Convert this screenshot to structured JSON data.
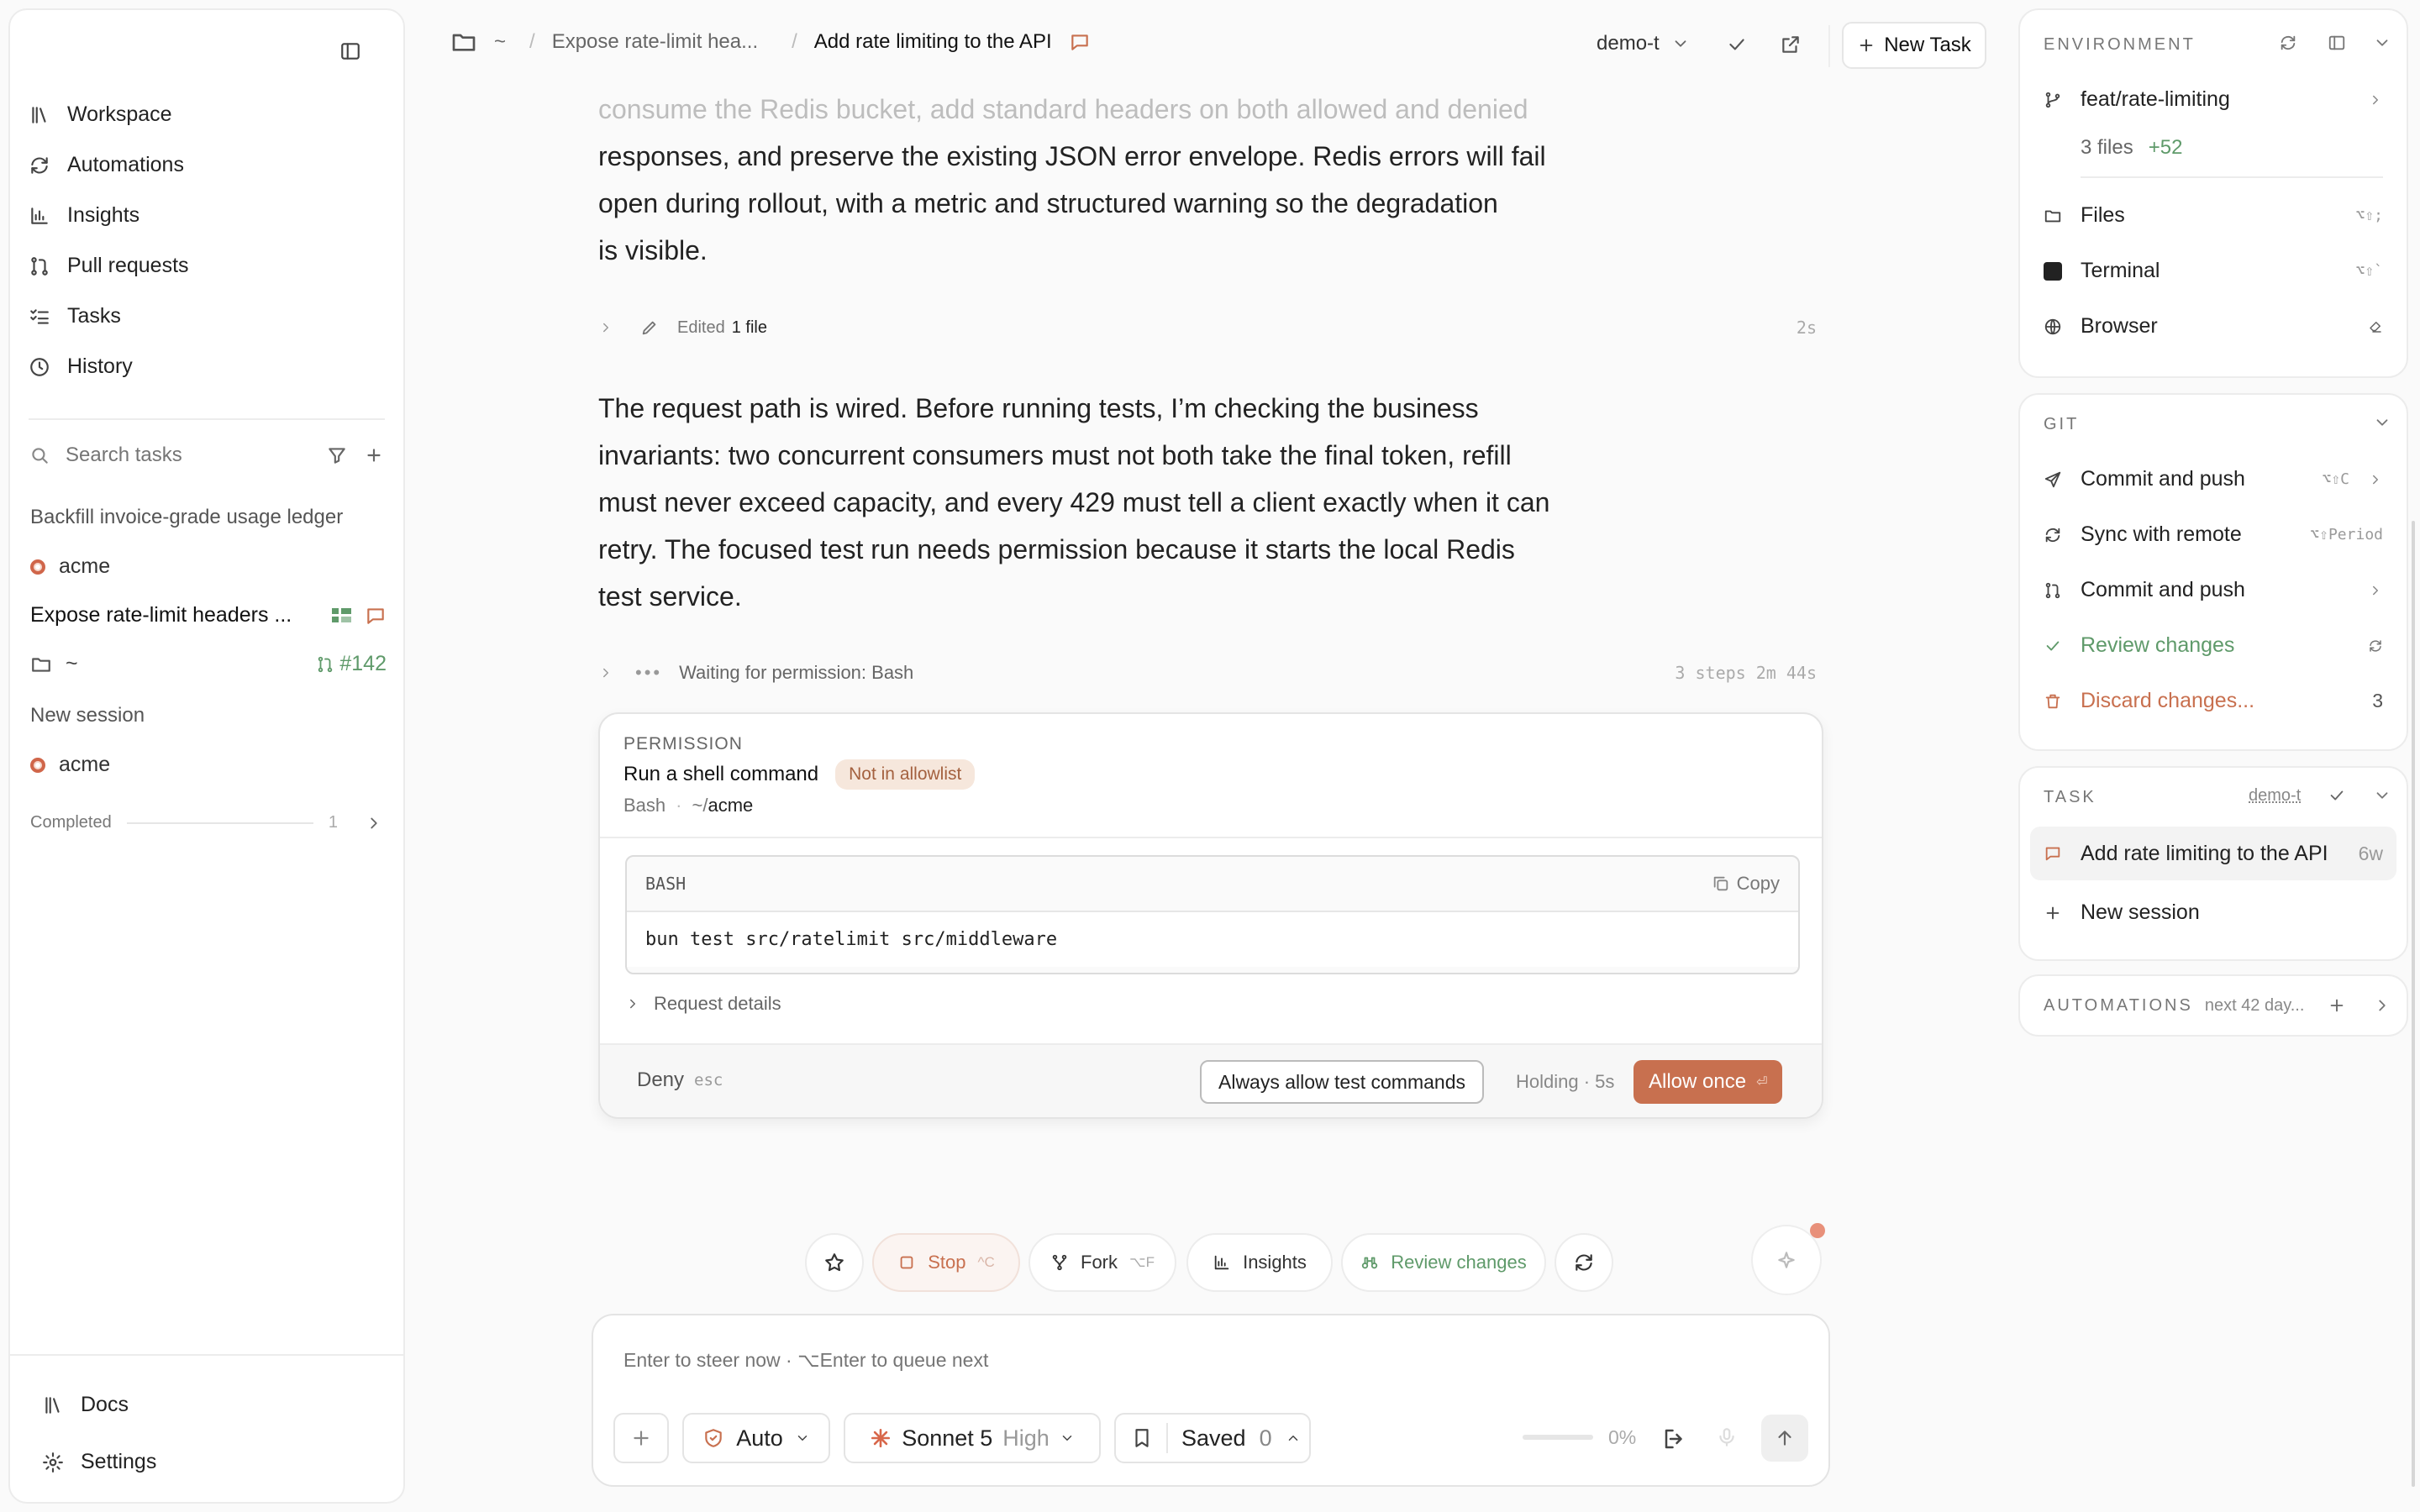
{
  "sidebar": {
    "nav": [
      "Workspace",
      "Automations",
      "Insights",
      "Pull requests",
      "Tasks",
      "History"
    ],
    "search_placeholder": "Search tasks",
    "tasks": [
      {
        "title": "Backfill invoice-grade usage ledger",
        "repo": "acme"
      },
      {
        "title": "Expose rate-limit headers ...",
        "dir": "~",
        "pr": "#142"
      },
      {
        "title": "New session",
        "repo": "acme"
      }
    ],
    "completed_label": "Completed",
    "completed_count": "1",
    "docs": "Docs",
    "settings": "Settings"
  },
  "header": {
    "crumb_home": "~",
    "crumb_parent": "Expose rate-limit hea...",
    "crumb_current": "Add rate limiting to the API",
    "branch_select": "demo-t",
    "new_task": "New Task"
  },
  "conversation": {
    "para1_faded": "consume the Redis bucket, add standard headers on both allowed and denied",
    "para1": [
      "responses, and preserve the existing JSON error envelope. Redis errors will fail",
      "open during rollout, with a metric and structured warning so the degradation",
      "is visible."
    ],
    "edited_prefix": "Edited",
    "edited_count": "1 file",
    "edited_time": "2s",
    "para2": [
      "The request path is wired. Before running tests, I’m checking the business",
      "invariants: two concurrent consumers must not both take the final token, refill",
      "must never exceed capacity, and every 429 must tell a client exactly when it can",
      "retry. The focused test run needs permission because it starts the local Redis",
      "test service."
    ],
    "waiting": "Waiting for permission: Bash",
    "waiting_stats": "3 steps 2m 44s"
  },
  "permission": {
    "label": "PERMISSION",
    "title": "Run a shell command",
    "badge": "Not in allowlist",
    "tool": "Bash",
    "path_prefix": "~/",
    "path": "acme",
    "code_lang": "BASH",
    "copy": "Copy",
    "command": "bun test src/ratelimit src/middleware",
    "details": "Request details",
    "deny": "Deny",
    "deny_key": "esc",
    "always": "Always allow test commands",
    "holding": "Holding · 5s",
    "allow": "Allow once"
  },
  "toolbar": {
    "stop": "Stop",
    "stop_key": "^C",
    "fork": "Fork",
    "fork_key": "⌥F",
    "insights": "Insights",
    "review": "Review changes"
  },
  "composer": {
    "placeholder": "Enter to steer now · ⌥Enter to queue next",
    "mode": "Auto",
    "model": "Sonnet 5",
    "effort": "High",
    "saved": "Saved",
    "saved_count": "0",
    "progress": "0%"
  },
  "right": {
    "env": {
      "label": "ENVIRONMENT",
      "branch": "feat/rate-limiting",
      "files": "3 files",
      "added": "+52",
      "rows": [
        {
          "label": "Files",
          "key": "⌥⇧;"
        },
        {
          "label": "Terminal",
          "key": "⌥⇧`"
        },
        {
          "label": "Browser",
          "key": ""
        }
      ]
    },
    "git": {
      "label": "GIT",
      "commit": "Commit and push",
      "commit_key": "⌥⇧C",
      "sync": "Sync with remote",
      "sync_key": "⌥⇧Period",
      "commit2": "Commit and push",
      "review": "Review changes",
      "discard": "Discard changes...",
      "discard_count": "3"
    },
    "task": {
      "label": "TASK",
      "tag": "demo-t",
      "item": "Add rate limiting to the API",
      "item_age": "6w",
      "new_session": "New session"
    },
    "automations": {
      "label": "AUTOMATIONS",
      "next": "next 42 day..."
    }
  },
  "colors": {
    "accent": "#c8704f",
    "green": "#5f9a6a",
    "badge_bg": "#f6e7dc",
    "badge_text": "#a4613f"
  }
}
